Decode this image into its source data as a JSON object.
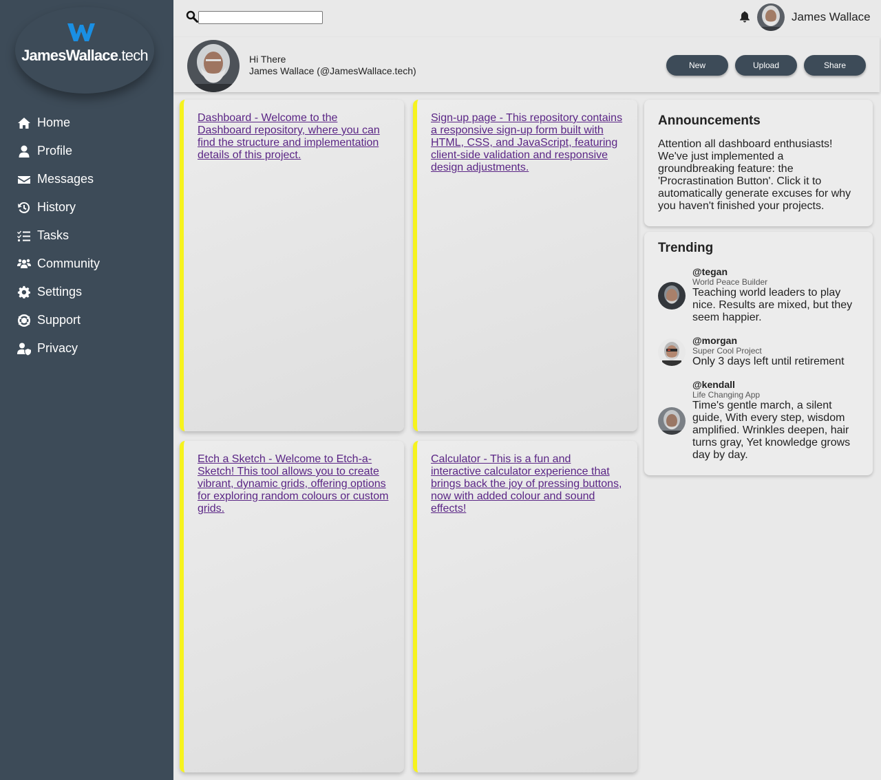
{
  "brand": {
    "logo_bold": "JamesWallace",
    "logo_thin": ".tech",
    "accent": "#1a8fe3"
  },
  "sidebar": {
    "items": [
      {
        "label": "Home",
        "icon": "home-icon"
      },
      {
        "label": "Profile",
        "icon": "user-icon"
      },
      {
        "label": "Messages",
        "icon": "envelope-icon"
      },
      {
        "label": "History",
        "icon": "history-icon"
      },
      {
        "label": "Tasks",
        "icon": "tasks-icon"
      },
      {
        "label": "Community",
        "icon": "community-icon"
      },
      {
        "label": "Settings",
        "icon": "gear-icon"
      },
      {
        "label": "Support",
        "icon": "lifebuoy-icon"
      },
      {
        "label": "Privacy",
        "icon": "user-shield-icon"
      }
    ]
  },
  "header": {
    "search_value": "",
    "user_name": "James Wallace"
  },
  "welcome": {
    "greeting": "Hi There",
    "user_line": "James Wallace (@JamesWallace.tech)",
    "buttons": {
      "new": "New",
      "upload": "Upload",
      "share": "Share"
    }
  },
  "projects": [
    {
      "text": "Dashboard - Welcome to the Dashboard repository, where you can find the structure and implementation details of this project."
    },
    {
      "text": "Sign-up page - This repository contains a responsive sign-up form built with HTML, CSS, and JavaScript, featuring client-side validation and responsive design adjustments."
    },
    {
      "text": "Etch a Sketch - Welcome to Etch-a-Sketch! This tool allows you to create vibrant, dynamic grids, offering options for exploring random colours or custom grids."
    },
    {
      "text": "Calculator - This is a fun and interactive calculator experience that brings back the joy of pressing buttons, now with added colour and sound effects!"
    }
  ],
  "announcements": {
    "title": "Announcements",
    "text": "Attention all dashboard enthusiasts! We've just implemented a groundbreaking feature: the 'Procrastination Button'. Click it to automatically generate excuses for why you haven't finished your projects."
  },
  "trending": {
    "title": "Trending",
    "items": [
      {
        "handle": "@tegan",
        "project": "World Peace Builder",
        "text": "Teaching world leaders to play nice. Results are mixed, but they seem happier."
      },
      {
        "handle": "@morgan",
        "project": "Super Cool Project",
        "text": "Only 3 days left until retirement"
      },
      {
        "handle": "@kendall",
        "project": "Life Changing App",
        "text": "Time's gentle march, a silent guide, With every step, wisdom amplified. Wrinkles deepen, hair turns gray, Yet knowledge grows day by day."
      }
    ]
  },
  "colors": {
    "sidebar": "#3d4b58",
    "card_accent": "#f6f31e",
    "link": "#5a2585",
    "background": "#e9e9e9"
  }
}
